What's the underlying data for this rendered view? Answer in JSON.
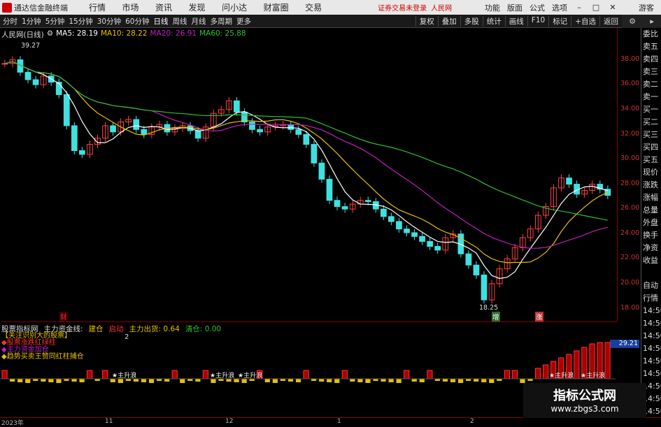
{
  "titlebar": {
    "app_name": "通达信金融终端",
    "menu": [
      "行情",
      "市场",
      "资讯",
      "发现",
      "问小达",
      "财富圈",
      "交易"
    ],
    "notice": "证券交易未登录",
    "stock_name": "人民网",
    "right_menu": [
      "功能",
      "版面",
      "公式",
      "选项"
    ],
    "guest": "游客"
  },
  "toolbar": {
    "periods": [
      "分时",
      "1分钟",
      "5分钟",
      "15分钟",
      "30分钟",
      "60分钟",
      "日线",
      "周线",
      "月线",
      "多周期",
      "更多"
    ],
    "right_buttons": [
      "复权",
      "叠加",
      "多股",
      "统计",
      "画线",
      "F10",
      "标记",
      "+自选",
      "返回"
    ]
  },
  "chart_header": {
    "title": "人民网(日线)",
    "ma5": "MA5: 28.19",
    "ma10": "MA10: 28.22",
    "ma20": "MA20: 26.91",
    "ma60": "MA60: 25.88"
  },
  "price_labels": {
    "high": "39.27",
    "low": "18.25"
  },
  "axis": [
    "38.00",
    "36.00",
    "34.00",
    "32.00",
    "30.00",
    "28.00",
    "26.00",
    "24.00",
    "22.00",
    "20.00",
    "18.00"
  ],
  "right_panel": [
    "委比",
    "卖五",
    "卖四",
    "卖三",
    "卖二",
    "卖一",
    "买一",
    "买二",
    "买三",
    "买四",
    "买五",
    "现价",
    "涨跌",
    "涨幅",
    "总量",
    "外盘",
    "换手",
    "净资",
    "收益",
    "",
    "自动",
    "行情",
    "14:50",
    "14:50",
    "14:50",
    "14:50",
    "14:50",
    "14:50",
    "14:50",
    "14:50",
    "14:50"
  ],
  "marks": {
    "cai": "财",
    "sheng": "增",
    "zhang": "涨"
  },
  "indicator": {
    "name": "股票指标网",
    "line1": "主力资金线:",
    "warn1": "建仓",
    "warn2": "启动",
    "line2": "主力出货: 0.64",
    "line3": "清仓: 0.00",
    "value": "29.21",
    "legend": [
      "【关注识别大的股票】",
      "◆股票涨跌红绿柱",
      "◆主力资金加仓",
      "◆趋势买卖王赞同红柱捕仓"
    ],
    "legend_val": "2",
    "labels": [
      "主升浪",
      "主升浪",
      "主升浪",
      "主升浪",
      "主升浪"
    ]
  },
  "bottom_axis": [
    "2023年",
    "11",
    "12",
    "1",
    "2"
  ],
  "watermark": {
    "title": "指标公式网",
    "url": "www.zbgs3.com"
  },
  "colors": {
    "up": "#ff4040",
    "down": "#40e0e0",
    "ma5": "#ffffff",
    "ma10": "#e6c000",
    "ma20": "#c020c0",
    "ma60": "#30c030"
  }
}
